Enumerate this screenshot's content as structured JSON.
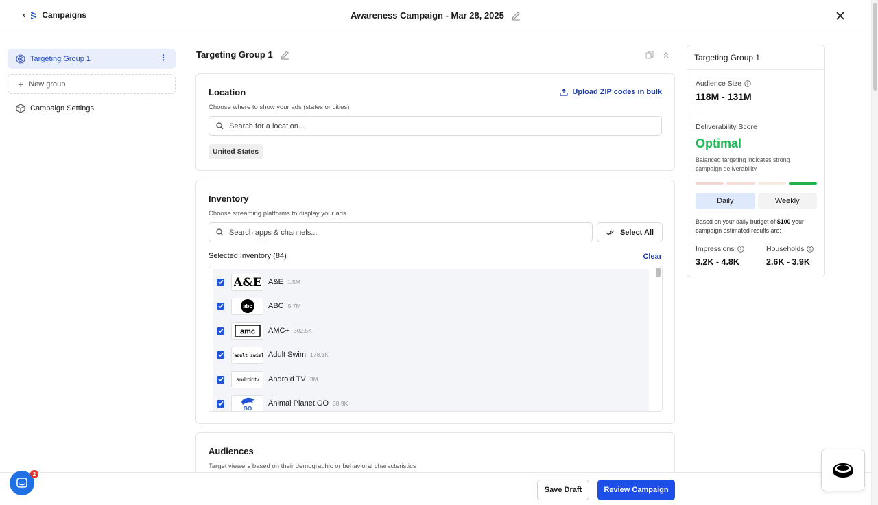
{
  "header": {
    "back_label": "Campaigns",
    "title": "Awareness Campaign - Mar 28, 2025"
  },
  "sidebar": {
    "items": [
      {
        "label": "Targeting Group 1"
      },
      {
        "label": "New group"
      },
      {
        "label": "Campaign Settings"
      }
    ]
  },
  "main": {
    "group_title": "Targeting Group 1",
    "location": {
      "title": "Location",
      "subtitle": "Choose where to show your ads (states or cities)",
      "upload_label": "Upload ZIP codes in bulk",
      "search_placeholder": "Search for a location...",
      "chips": [
        "United States"
      ]
    },
    "inventory": {
      "title": "Inventory",
      "subtitle": "Choose streaming platforms to display your ads",
      "search_placeholder": "Search apps & channels...",
      "select_all_label": "Select All",
      "selected_label": "Selected Inventory (84)",
      "clear_label": "Clear",
      "items": [
        {
          "name": "A&E",
          "count": "1.5M",
          "logo": "ae-logo"
        },
        {
          "name": "ABC",
          "count": "5.7M",
          "logo": "abc-logo"
        },
        {
          "name": "AMC+",
          "count": "302.5K",
          "logo": "amc-logo"
        },
        {
          "name": "Adult Swim",
          "count": "178.1K",
          "logo": "adult-swim-logo"
        },
        {
          "name": "Android TV",
          "count": "3M",
          "logo": "android-tv-logo"
        },
        {
          "name": "Animal Planet GO",
          "count": "38.9K",
          "logo": "animal-planet-go-logo"
        }
      ]
    },
    "audiences": {
      "title": "Audiences",
      "subtitle": "Target viewers based on their demographic or behavioral characteristics"
    }
  },
  "summary": {
    "title": "Targeting Group 1",
    "audience_size_label": "Audience Size",
    "audience_size_value": "118M - 131M",
    "deliverability_label": "Deliverability Score",
    "deliverability_value": "Optimal",
    "deliverability_desc": "Balanced targeting indicates strong campaign deliverability",
    "toggle_daily": "Daily",
    "toggle_weekly": "Weekly",
    "budget_note_pre": "Based on your daily budget of ",
    "budget_amount": "$100",
    "budget_note_post": " your campaign estimated results are:",
    "impressions_label": "Impressions",
    "impressions_value": "3.2K - 4.8K",
    "households_label": "Households",
    "households_value": "2.6K - 3.9K",
    "colors": {
      "optimal": "#1db954",
      "bar_low": "#f4d6d2",
      "bar_mid": "#f7e9dc",
      "bar_high": "#22b14c",
      "accent": "#1d4ee8"
    }
  },
  "footer": {
    "save_draft_label": "Save Draft",
    "review_label": "Review Campaign"
  },
  "chat": {
    "badge_count": "2"
  }
}
